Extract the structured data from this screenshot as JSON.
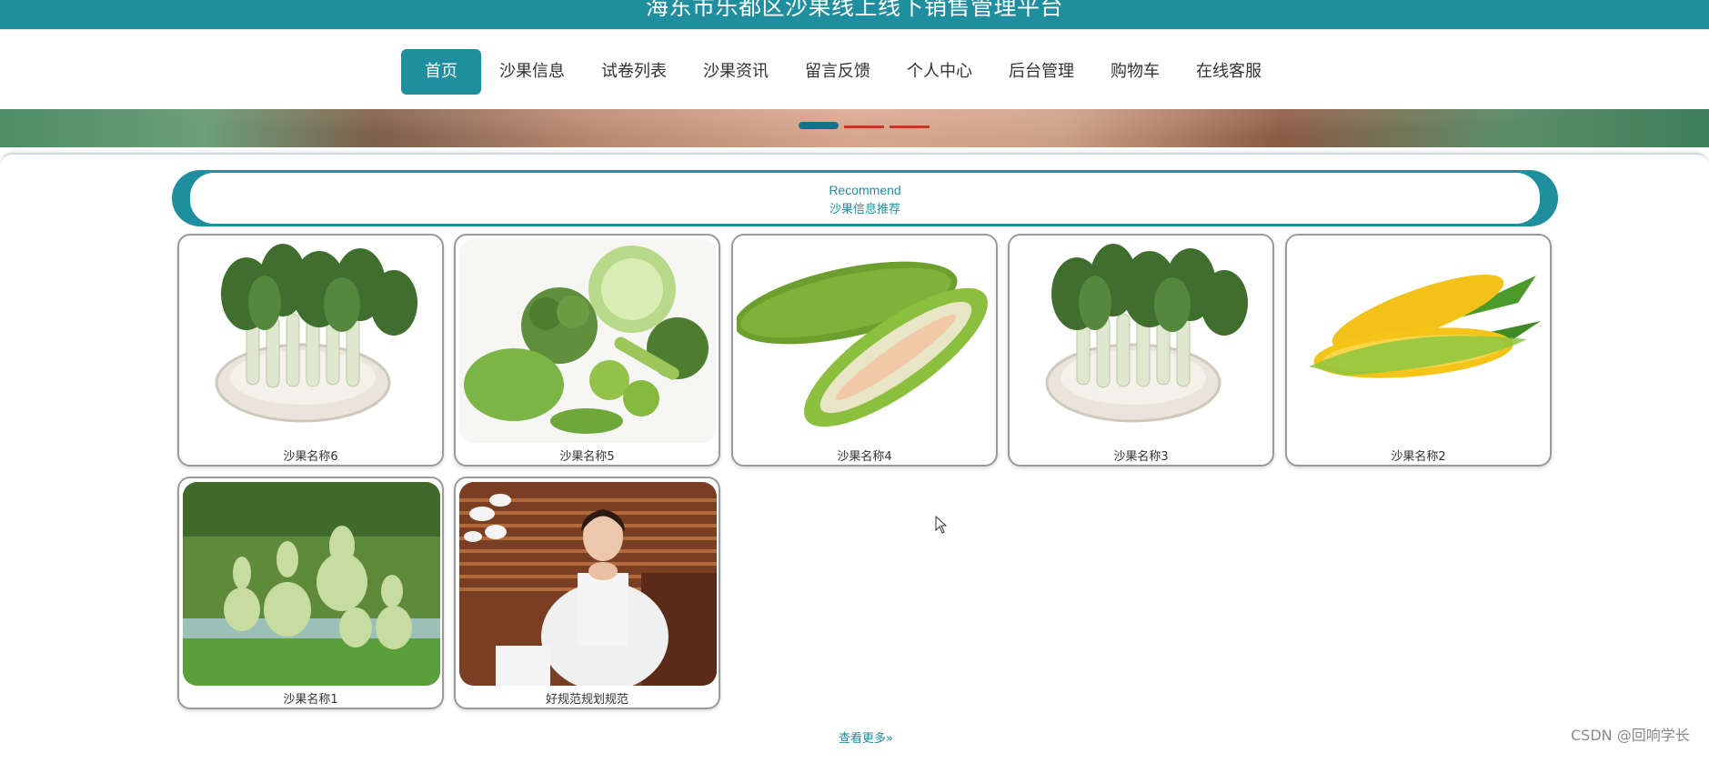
{
  "site": {
    "title": "海东市乐都区沙果线上线下销售管理平台"
  },
  "nav": {
    "items": [
      {
        "label": "首页",
        "active": true
      },
      {
        "label": "沙果信息"
      },
      {
        "label": "试卷列表"
      },
      {
        "label": "沙果资讯"
      },
      {
        "label": "留言反馈"
      },
      {
        "label": "个人中心"
      },
      {
        "label": "后台管理"
      },
      {
        "label": "购物车"
      },
      {
        "label": "在线客服"
      }
    ]
  },
  "banner": {
    "dot_count": 3,
    "active_dot": 0
  },
  "recommend": {
    "title_en": "Recommend",
    "title_cn": "沙果信息推荐",
    "products": [
      {
        "name": "沙果名称6",
        "image": "bok-choy-plate-image"
      },
      {
        "name": "沙果名称5",
        "image": "mixed-vegetables-image"
      },
      {
        "name": "沙果名称4",
        "image": "bitter-melon-image"
      },
      {
        "name": "沙果名称3",
        "image": "bok-choy-plate-image"
      },
      {
        "name": "沙果名称2",
        "image": "corn-image"
      },
      {
        "name": "沙果名称1",
        "image": "gourd-vine-image"
      },
      {
        "name": "好规范规划规范",
        "image": "woman-portrait-image"
      }
    ],
    "more_label": "查看更多»"
  },
  "watermark": "CSDN @回响学长",
  "colors": {
    "primary": "#1f8e9e",
    "dot_inactive": "#c0392b",
    "dot_active": "#1a6f8c"
  }
}
